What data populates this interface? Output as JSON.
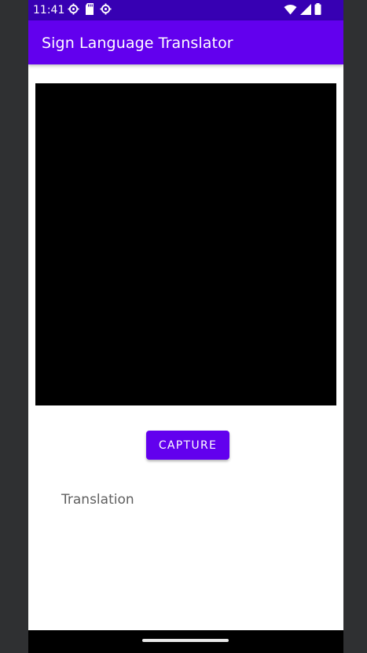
{
  "status_bar": {
    "time": "11:41",
    "left_icons": [
      "settings-icon",
      "sd-card-icon",
      "settings-icon"
    ],
    "right_icons": [
      "wifi-icon",
      "cellular-signal-icon",
      "battery-icon"
    ]
  },
  "app_bar": {
    "title": "Sign Language Translator",
    "color": "#6200ee",
    "status_color": "#3700b3"
  },
  "camera_preview": {
    "background": "#000000"
  },
  "capture_button": {
    "label": "CAPTURE"
  },
  "translation": {
    "text": "Translation"
  },
  "navigation": {
    "handle": "home-gesture-handle"
  }
}
